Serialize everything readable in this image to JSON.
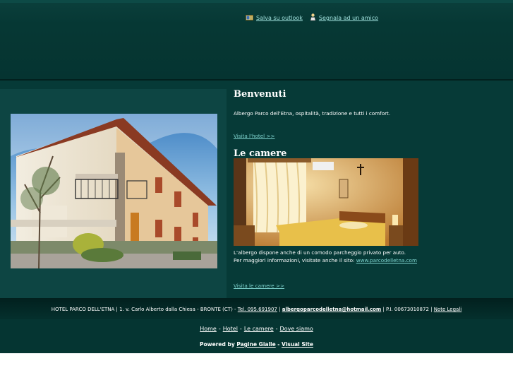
{
  "header": {
    "links": [
      {
        "label": "Salva su outlook",
        "icon": "outlook-save-icon"
      },
      {
        "label": "Segnala ad un amico",
        "icon": "tell-friend-icon"
      }
    ]
  },
  "intro": {
    "title": "Benvenuti",
    "text": "Albergo Parco dell'Etna, ospitalità, tradizione e tutti i comfort.",
    "link": "Visita l'hotel >>"
  },
  "rooms": {
    "title": "Le camere",
    "text1": "L'albergo dispone anche di un comodo parcheggio privato per auto.",
    "text2_prefix": "Per maggiori informazioni, visitate anche il sito: ",
    "text2_link": "www.parcodelletna.com",
    "link": "Visita le camere >>"
  },
  "footer": {
    "address": "HOTEL PARCO DELL'ETNA | 1. v. Carlo Alberto dalla Chiesa - BRONTE (CT) - ",
    "phone": "Tel. 095.691907",
    "sep1": " | ",
    "email": "albergoparcodelletna@hotmail.com",
    "piva": " | P.I. 00673010872 | ",
    "legal": "Note Legali",
    "nav": [
      "Home",
      "Hotel",
      "Le camere",
      "Dove siamo"
    ],
    "nav_sep": "-",
    "powered_prefix": "Powered by ",
    "powered_link1": "Pagine Gialle",
    "powered_sep": " - ",
    "powered_link2": "Visual Site"
  },
  "colors": {
    "background": "#053532",
    "panel": "#0d4543",
    "link": "#7fd4cf"
  }
}
